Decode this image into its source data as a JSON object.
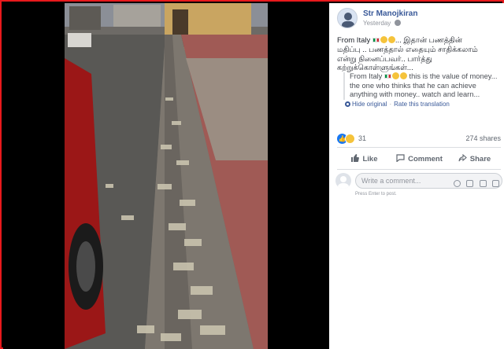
{
  "post": {
    "author": "Str Manojkiran",
    "time": "Yesterday",
    "text_line1": "From Italy",
    "text_line1_rest": "... இதான் பணத்தின்",
    "text_line2": "மதிப்பு .. பணத்தால் எதையும் சாதிக்கலாம்",
    "text_line3": "என்று நினைப்பவர்.. பார்த்து",
    "text_line4": "கற்றுக்கொள்ளுங்கள்...",
    "translation_prefix": "From Italy",
    "translation_rest": "this is the value of money... the one who thinks that he can achieve anything with money.. watch and learn...",
    "hide_original": "Hide original",
    "rate_translation": "Rate this translation"
  },
  "stats": {
    "reactions": "31",
    "shares": "274 shares"
  },
  "actions": {
    "like": "Like",
    "comment": "Comment",
    "share": "Share"
  },
  "comment": {
    "placeholder": "Write a comment...",
    "hint": "Press Enter to post."
  },
  "colors": {
    "frame": "#e8191c",
    "link": "#385898",
    "accent": "#1877f2"
  },
  "icons": [
    "globe-icon",
    "italy-flag-icon",
    "worried-emoji-icon",
    "gear-icon",
    "like-reaction-icon",
    "sad-reaction-icon",
    "like-icon",
    "comment-icon",
    "share-icon",
    "emoji-icon",
    "camera-icon",
    "gif-icon",
    "sticker-icon"
  ]
}
